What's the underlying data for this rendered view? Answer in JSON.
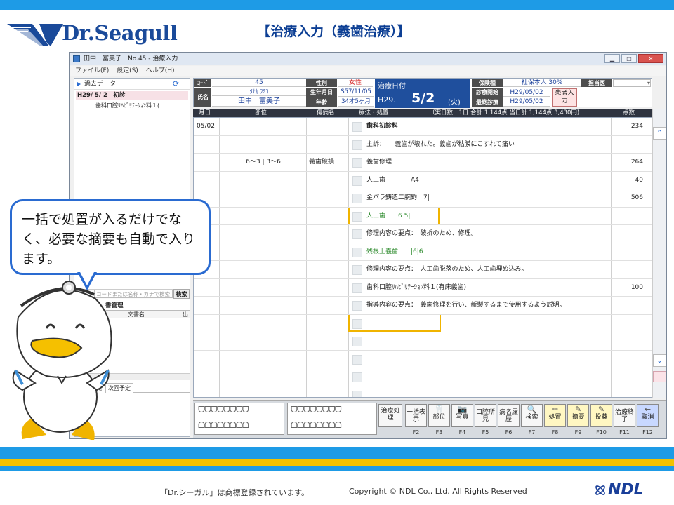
{
  "brand": {
    "logo_text": "Dr.Seagull",
    "slide_title": "【治療入力（義歯治療）】"
  },
  "window": {
    "title": "田中　富美子　No.45 - 治療入力",
    "menu": [
      "ファイル(F)",
      "設定(S)",
      "ヘルプ(H)"
    ]
  },
  "left": {
    "past_data": "過去データ",
    "visit_date": "H29/ 5/ 2",
    "visit_type": "初診",
    "visit_item": "歯科口腔ﾘﾊﾋﾞﾘﾃｰｼｮﾝ料１(",
    "search_placeholder": "コードまたは名称・カナで検索",
    "search_button": "検索",
    "docs_title": "書管理",
    "doc_col": "文書名",
    "doc_col2": "出",
    "tab1": "モ",
    "tab2": "次回予定"
  },
  "patient": {
    "code_label": "ｺｰﾄﾞ",
    "code": "45",
    "sex_label": "性別",
    "sex": "女性",
    "name_label": "氏名",
    "kana": "ﾀﾅｶ ﾌﾐｺ",
    "name": "田中　富美子",
    "dob_label": "生年月日",
    "dob": "S57/11/05",
    "age_label": "年齢",
    "age": "34才5ヶ月",
    "treat_date_label": "治療日付",
    "era": "H29.",
    "date": "5/2",
    "dow": "(火)",
    "ins_label": "保険種",
    "ins": "社保本人 30%",
    "doctor_label": "担当医",
    "start_label": "診療開始",
    "start": "H29/05/02",
    "last_label": "最終診療",
    "last": "H29/05/02",
    "patient_button": "患者入力"
  },
  "grid": {
    "headers": {
      "date": "月日",
      "site": "部位",
      "disease": "傷病名",
      "treatment": "療法・処置",
      "summary": "（実日数　1日 合計 1,144点 当日計 1,144点 3,430円)",
      "points": "点数"
    },
    "rows": [
      {
        "date": "05/02",
        "site": "",
        "disease": "",
        "treatment": "歯科初診料",
        "points": "234",
        "bold": true
      },
      {
        "date": "",
        "site": "",
        "disease": "",
        "treatment": "主訴：　　義歯が壊れた。義歯が粘膜にこすれて痛い",
        "points": ""
      },
      {
        "date": "",
        "site": "6～3 | 3～6",
        "disease": "義歯破損",
        "treatment": "義歯修理",
        "points": "264"
      },
      {
        "date": "",
        "site": "",
        "disease": "",
        "treatment": "人工歯　　　　A4",
        "points": "40"
      },
      {
        "date": "",
        "site": "",
        "disease": "",
        "treatment": "金パラ鋳造二腕鉤　7|",
        "points": "506"
      },
      {
        "date": "",
        "site": "",
        "disease": "",
        "treatment": "人工歯　　6 5|",
        "points": "",
        "green": true
      },
      {
        "date": "",
        "site": "",
        "disease": "",
        "treatment": "修理内容の要点：　破折のため、修理。",
        "points": ""
      },
      {
        "date": "",
        "site": "",
        "disease": "",
        "treatment": "残根上義歯　　|6|6",
        "points": "",
        "green": true
      },
      {
        "date": "",
        "site": "",
        "disease": "",
        "treatment": "修理内容の要点：　人工歯脱落のため、人工歯埋め込み。",
        "points": ""
      },
      {
        "date": "",
        "site": "",
        "disease": "",
        "treatment": "歯科口腔ﾘﾊﾋﾞﾘﾃｰｼｮﾝ料１(有床義歯)",
        "points": "100"
      },
      {
        "date": "",
        "site": "",
        "disease": "",
        "treatment": "指導内容の要点：　義歯修理を行い、新製するまで使用するよう説明。",
        "points": ""
      },
      {
        "date": "",
        "site": "",
        "disease": "",
        "treatment": "",
        "points": ""
      },
      {
        "date": "",
        "site": "",
        "disease": "",
        "treatment": "",
        "points": ""
      },
      {
        "date": "",
        "site": "",
        "disease": "",
        "treatment": "",
        "points": ""
      },
      {
        "date": "",
        "site": "",
        "disease": "",
        "treatment": "",
        "points": ""
      },
      {
        "date": "",
        "site": "",
        "disease": "",
        "treatment": "",
        "points": ""
      }
    ]
  },
  "toolbar": {
    "treat_proc": "治療処理",
    "buttons": [
      {
        "label": "一括表示",
        "key": "F2",
        "icon": ""
      },
      {
        "label": "部位",
        "key": "F3",
        "icon": "🦷"
      },
      {
        "label": "写真",
        "key": "F4",
        "icon": "📷"
      },
      {
        "label": "口腔所見",
        "key": "F5",
        "icon": ""
      },
      {
        "label": "病名履歴",
        "key": "F6",
        "icon": ""
      },
      {
        "label": "検索",
        "key": "F7",
        "icon": "🔍"
      },
      {
        "label": "処置",
        "key": "F8",
        "icon": "✏"
      },
      {
        "label": "摘要",
        "key": "F9",
        "icon": "✎"
      },
      {
        "label": "投薬",
        "key": "F10",
        "icon": "✎"
      },
      {
        "label": "治療終了",
        "key": "F11",
        "icon": ""
      },
      {
        "label": "取消",
        "key": "F12",
        "icon": "←"
      }
    ]
  },
  "callout": {
    "text": "一括で処置が入るだけでなく、必要な摘要も自動で入ります。"
  },
  "footer": {
    "trademark": "「Dr.シーガル」は商標登録されています。",
    "copyright": "Copyright © NDL Co., Ltd. All Rights Reserved",
    "ndl": "NDL"
  }
}
